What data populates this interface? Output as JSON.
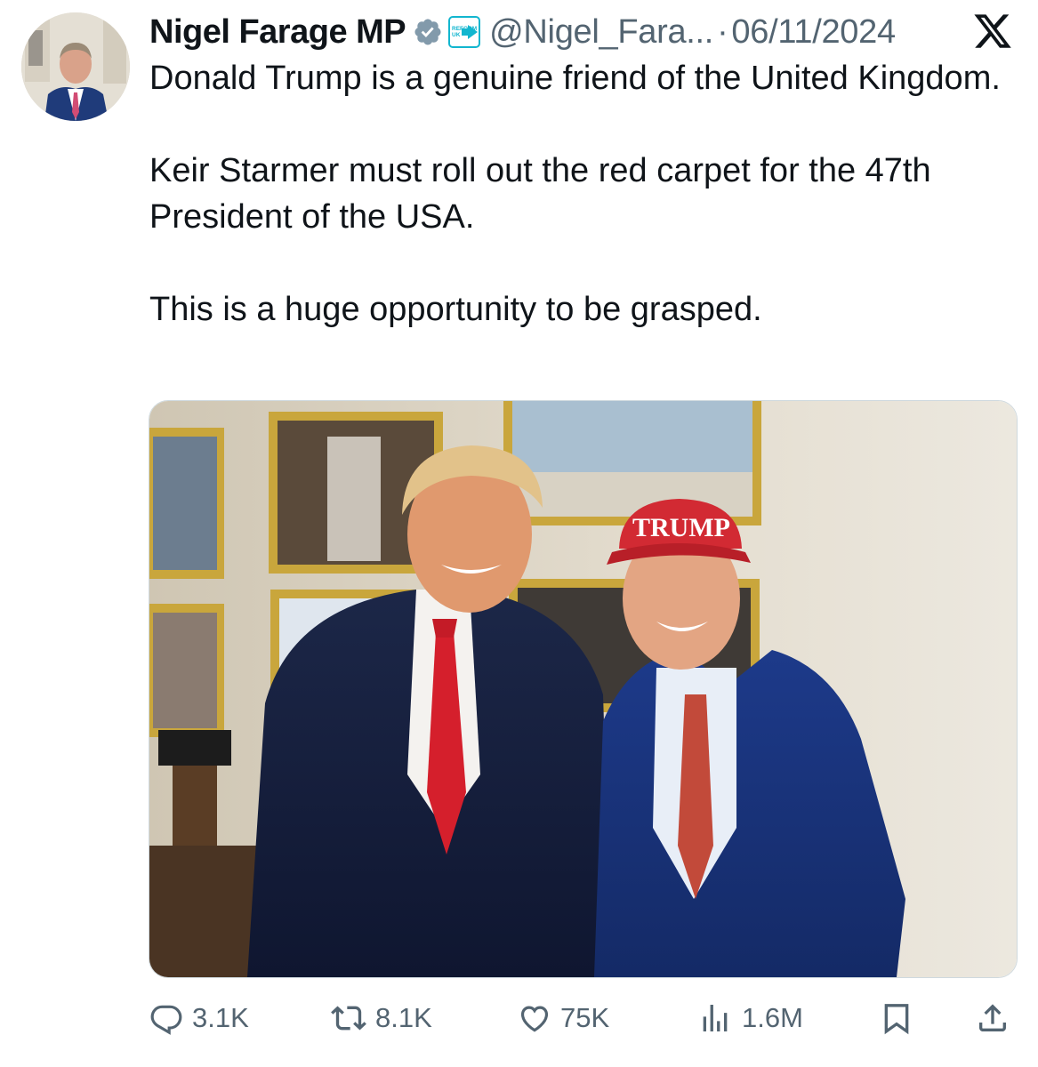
{
  "tweet": {
    "author_name": "Nigel Farage MP",
    "handle": "@Nigel_Fara...",
    "separator": "·",
    "date": "06/11/2024",
    "badge_text_top": "REFORM",
    "badge_text_bottom": "UK",
    "paragraphs": [
      "Donald Trump is a genuine friend of the United Kingdom.",
      "Keir Starmer must roll out the red carpet for the 47th President of the USA.",
      "This is a huge opportunity to be grasped."
    ],
    "media": {
      "cap_text": "TRUMP"
    }
  },
  "actions": {
    "replies": "3.1K",
    "reposts": "8.1K",
    "likes": "75K",
    "views": "1.6M"
  },
  "icons": [
    "verified-icon",
    "reform-uk-badge-icon",
    "x-logo-icon",
    "reply-icon",
    "repost-icon",
    "like-icon",
    "views-icon",
    "bookmark-icon",
    "share-icon"
  ],
  "colors": {
    "text": "#0f1419",
    "secondary": "#536471",
    "verified": "#829aab",
    "reform": "#12b6cf"
  }
}
